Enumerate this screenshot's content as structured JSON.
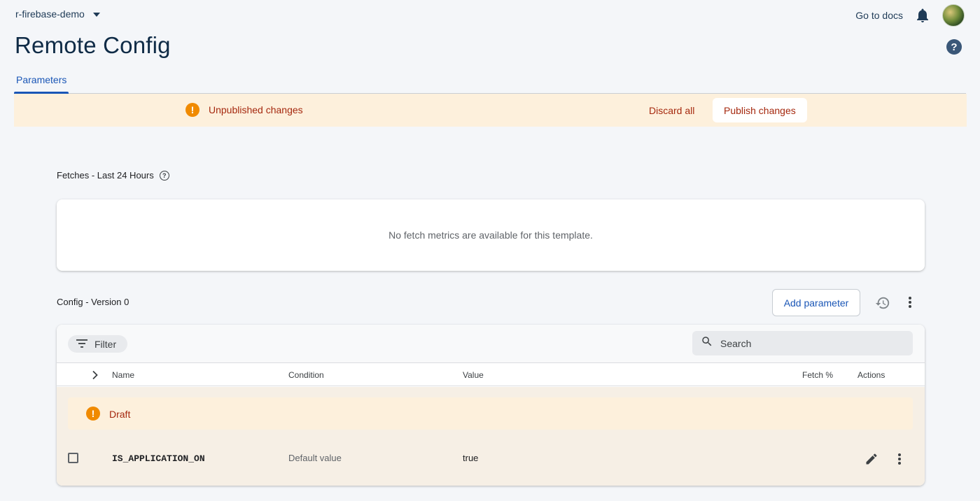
{
  "topbar": {
    "project_name": "r-firebase-demo",
    "docs_link": "Go to docs"
  },
  "page": {
    "title": "Remote Config",
    "help_glyph": "?"
  },
  "tabs": [
    {
      "label": "Parameters",
      "active": true
    }
  ],
  "banner": {
    "icon_glyph": "!",
    "message": "Unpublished changes",
    "discard_label": "Discard all",
    "publish_label": "Publish changes"
  },
  "fetches": {
    "label": "Fetches - Last 24 Hours",
    "empty_message": "No fetch metrics are available for this template."
  },
  "config": {
    "label": "Config - Version 0",
    "add_parameter_label": "Add parameter",
    "filter_label": "Filter",
    "search_placeholder": "Search",
    "columns": {
      "name": "Name",
      "condition": "Condition",
      "value": "Value",
      "fetch_percent": "Fetch %",
      "actions": "Actions"
    },
    "draft_label": "Draft",
    "rows": [
      {
        "name": "IS_APPLICATION_ON",
        "condition": "Default value",
        "value": "true",
        "checked": false
      }
    ]
  },
  "colors": {
    "accent_blue": "#1a56b6",
    "warning_orange": "#f08a00",
    "warning_text": "#a5280e",
    "banner_bg": "#fdf0dc",
    "title_navy": "#0f2b46"
  },
  "icons": {
    "project_dropdown": "chevron-down-icon",
    "notifications": "bell-icon",
    "help": "help-circle-icon",
    "warning": "exclamation-circle-icon",
    "filter": "filter-lines-icon",
    "search": "magnifier-icon",
    "history": "history-clock-icon",
    "more": "more-vertical-icon",
    "expand": "chevron-right-icon",
    "edit": "pencil-icon"
  }
}
